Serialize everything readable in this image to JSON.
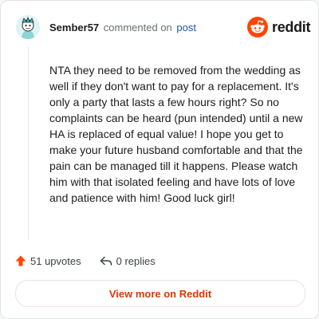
{
  "comment": {
    "author": "Sember57",
    "action_text": "commented on",
    "post_link": "post",
    "body": "NTA they need to be removed from the wedding as well if they don't want to pay for a replacement. It's only a party that lasts a few hours right? So no complaints can be heard (pun intended) until a new HA is replaced of equal value! I hope you get to make your future husband comfortable and that the pain can be managed till it happens. Please watch him with that isolated feeling and have lots of love and patience with him! Good luck girl!"
  },
  "brand": {
    "name": "reddit",
    "icon": "reddit-snoo-icon",
    "color": "#ff4500"
  },
  "stats": {
    "upvotes": "51 upvotes",
    "replies": "0 replies"
  },
  "footer": {
    "view_more": "View more on Reddit"
  },
  "colors": {
    "accent": "#d93a00",
    "upvote": "#ff4500",
    "link": "#1f56a6",
    "muted": "#6a6f73"
  }
}
